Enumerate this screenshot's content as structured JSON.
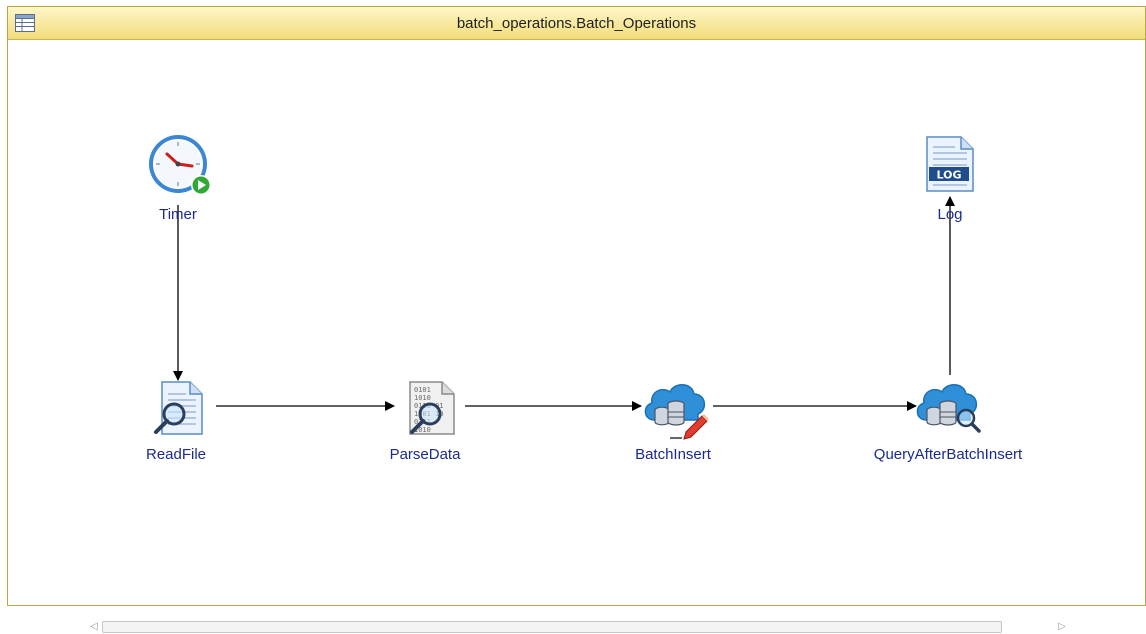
{
  "window": {
    "title": "batch_operations.Batch_Operations"
  },
  "diagram": {
    "nodes": [
      {
        "id": "timer",
        "label": "Timer",
        "icon": "clock-icon"
      },
      {
        "id": "readfile",
        "label": "ReadFile",
        "icon": "file-search-icon"
      },
      {
        "id": "parsedata",
        "label": "ParseData",
        "icon": "binary-search-icon"
      },
      {
        "id": "batchinsert",
        "label": "BatchInsert",
        "icon": "cloud-database-edit-icon"
      },
      {
        "id": "query",
        "label": "QueryAfterBatchInsert",
        "icon": "cloud-database-search-icon"
      },
      {
        "id": "log",
        "label": "Log",
        "icon": "log-file-icon",
        "icon_text": "LOG"
      }
    ],
    "edges": [
      {
        "from": "timer",
        "to": "readfile"
      },
      {
        "from": "readfile",
        "to": "parsedata"
      },
      {
        "from": "parsedata",
        "to": "batchinsert"
      },
      {
        "from": "batchinsert",
        "to": "query"
      },
      {
        "from": "query",
        "to": "log"
      }
    ]
  },
  "colors": {
    "titlebar": "#f4e08a",
    "label": "#1b2a8f",
    "edge": "#000000"
  }
}
